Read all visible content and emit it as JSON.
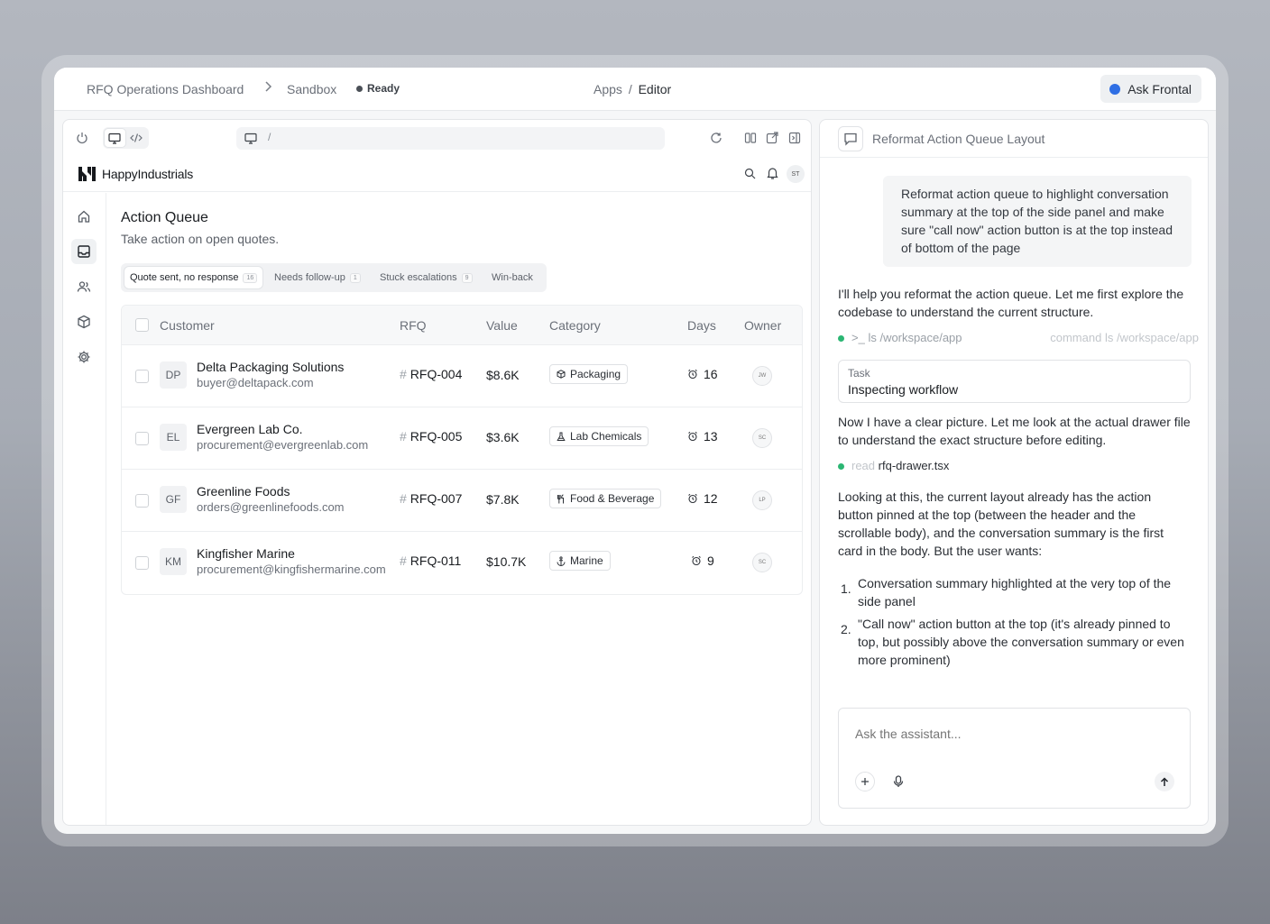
{
  "topbar": {
    "breadcrumb": [
      "RFQ Operations Dashboard",
      "Sandbox"
    ],
    "status": "Ready",
    "apps_label": "Apps",
    "apps_sep": "/",
    "apps_current": "Editor",
    "ask_button": "Ask Frontal"
  },
  "preview": {
    "url": "/",
    "brand": "HappyIndustrials",
    "avatar_initials": "ST",
    "page_title": "Action Queue",
    "page_subtitle": "Take action on open quotes.",
    "tabs": [
      {
        "label": "Quote sent, no response",
        "count": "16"
      },
      {
        "label": "Needs follow-up",
        "count": "1"
      },
      {
        "label": "Stuck escalations",
        "count": "9"
      },
      {
        "label": "Win-back",
        "count": ""
      }
    ],
    "table": {
      "headers": [
        "Customer",
        "RFQ",
        "Value",
        "Category",
        "Days",
        "Owner"
      ],
      "rows": [
        {
          "initials": "DP",
          "name": "Delta Packaging Solutions",
          "email": "buyer@deltapack.com",
          "rfq": "RFQ-004",
          "value": "$8.6K",
          "category": "Packaging",
          "category_icon": "box-icon",
          "days": "16",
          "owner": "JW"
        },
        {
          "initials": "EL",
          "name": "Evergreen Lab Co.",
          "email": "procurement@evergreenlab.com",
          "rfq": "RFQ-005",
          "value": "$3.6K",
          "category": "Lab Chemicals",
          "category_icon": "flask-icon",
          "days": "13",
          "owner": "SC"
        },
        {
          "initials": "GF",
          "name": "Greenline Foods",
          "email": "orders@greenlinefoods.com",
          "rfq": "RFQ-007",
          "value": "$7.8K",
          "category": "Food & Beverage",
          "category_icon": "utensils-icon",
          "days": "12",
          "owner": "LP"
        },
        {
          "initials": "KM",
          "name": "Kingfisher Marine",
          "email": "procurement@kingfishermarine.com",
          "rfq": "RFQ-011",
          "value": "$10.7K",
          "category": "Marine",
          "category_icon": "anchor-icon",
          "days": "9",
          "owner": "SC"
        }
      ]
    }
  },
  "chat": {
    "title": "Reformat Action Queue Layout",
    "user_message": "Reformat action queue to highlight conversation summary at the top of the side panel and make sure \"call now\" action button is at the top instead of bottom of the page",
    "ai_intro": "I'll help you reformat the action queue. Let me first explore the codebase to understand the current structure.",
    "cmd1_prompt": ">_",
    "cmd1": "ls /workspace/app",
    "cmd1_right": "command ls /workspace/app",
    "task_label": "Task",
    "task_value": "Inspecting workflow",
    "ai_second": "Now I have a clear picture. Let me look at the actual drawer file to understand the exact structure before editing.",
    "cmd2_verb": "read",
    "cmd2_file": "rfq-drawer.tsx",
    "ai_third": "Looking at this, the current layout already has the action button pinned at the top (between the header and the scrollable body), and the conversation summary is the first card in the body. But the user wants:",
    "steps": [
      {
        "num": "1.",
        "text": "Conversation summary highlighted at the very top of the side panel"
      },
      {
        "num": "2.",
        "text": "\"Call now\" action button at the top (it's already pinned to top, but possibly above the conversation summary or even more prominent)"
      }
    ],
    "composer_placeholder": "Ask the assistant..."
  },
  "colors": {
    "accent": "#2f6fe4",
    "status_green": "#2bb673"
  }
}
